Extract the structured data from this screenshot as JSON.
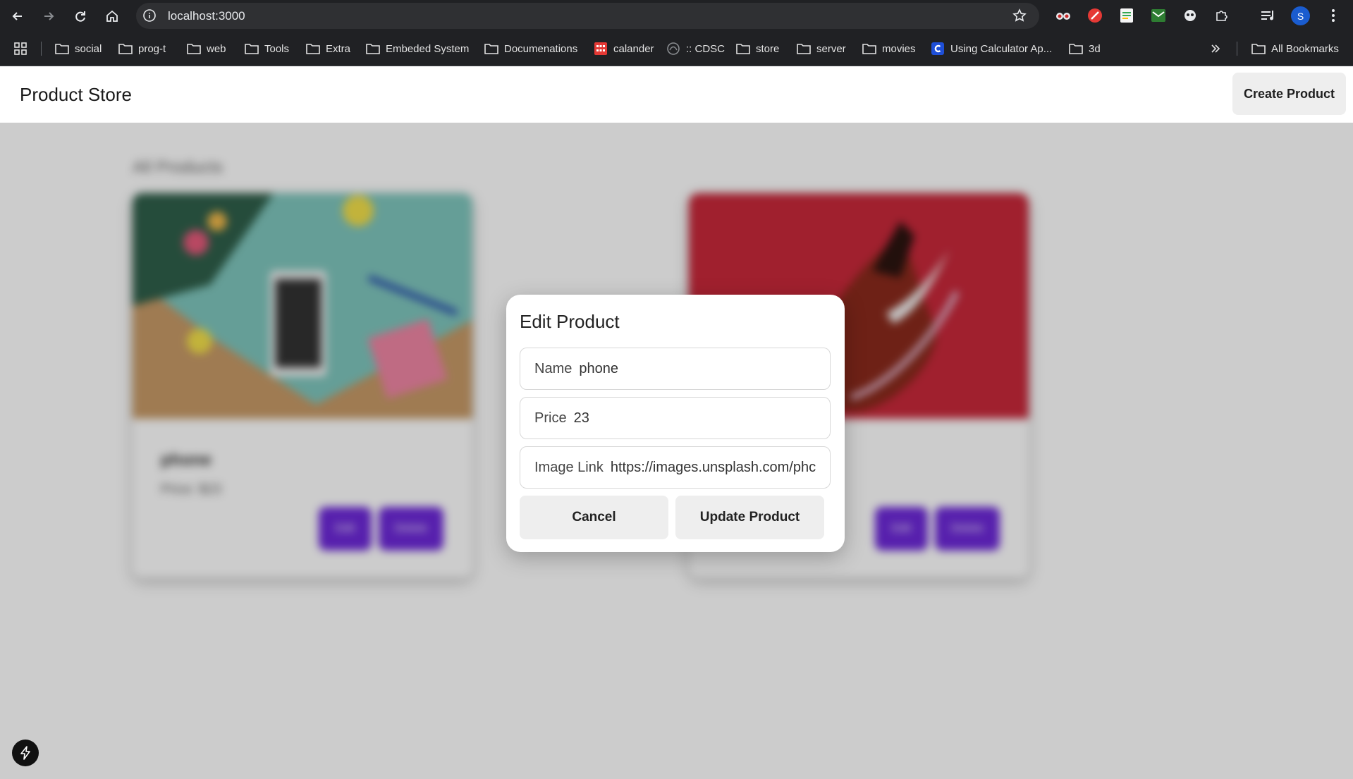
{
  "browser": {
    "url": "localhost:3000",
    "avatar_letter": "S",
    "bookmarks": [
      {
        "label": "social",
        "icon": "folder-icon"
      },
      {
        "label": "prog-t",
        "icon": "folder-icon"
      },
      {
        "label": "web",
        "icon": "folder-icon"
      },
      {
        "label": "Tools",
        "icon": "folder-icon"
      },
      {
        "label": "Extra",
        "icon": "folder-icon"
      },
      {
        "label": "Embeded System",
        "icon": "folder-icon"
      },
      {
        "label": "Documenations",
        "icon": "folder-icon"
      },
      {
        "label": "calander",
        "icon": "calendar-app-icon"
      },
      {
        "label": ":: CDSC",
        "icon": "cdsc-site-icon"
      },
      {
        "label": "store",
        "icon": "folder-icon"
      },
      {
        "label": "server",
        "icon": "folder-icon"
      },
      {
        "label": "movies",
        "icon": "folder-icon"
      },
      {
        "label": "Using Calculator Ap...",
        "icon": "calculator-site-icon"
      },
      {
        "label": "3d",
        "icon": "folder-icon"
      }
    ],
    "all_bookmarks_label": "All Bookmarks"
  },
  "header": {
    "title": "Product Store",
    "create_label": "Create Product"
  },
  "products_section": {
    "title": "All Products",
    "products": [
      {
        "name": "phone",
        "price": "Price: $23",
        "edit_label": "Edit",
        "delete_label": "Delete"
      },
      {
        "name": "",
        "price": "",
        "edit_label": "Edit",
        "delete_label": "Delete"
      }
    ]
  },
  "modal": {
    "title": "Edit Product",
    "name_label": "Name",
    "name_value": "phone",
    "price_label": "Price",
    "price_value": "23",
    "image_label": "Image Link",
    "image_value": "https://images.unsplash.com/phc",
    "cancel_label": "Cancel",
    "update_label": "Update Product"
  },
  "colors": {
    "accent": "#6d28d9",
    "chrome_bg": "#202124",
    "overlay": "#cccccc"
  }
}
